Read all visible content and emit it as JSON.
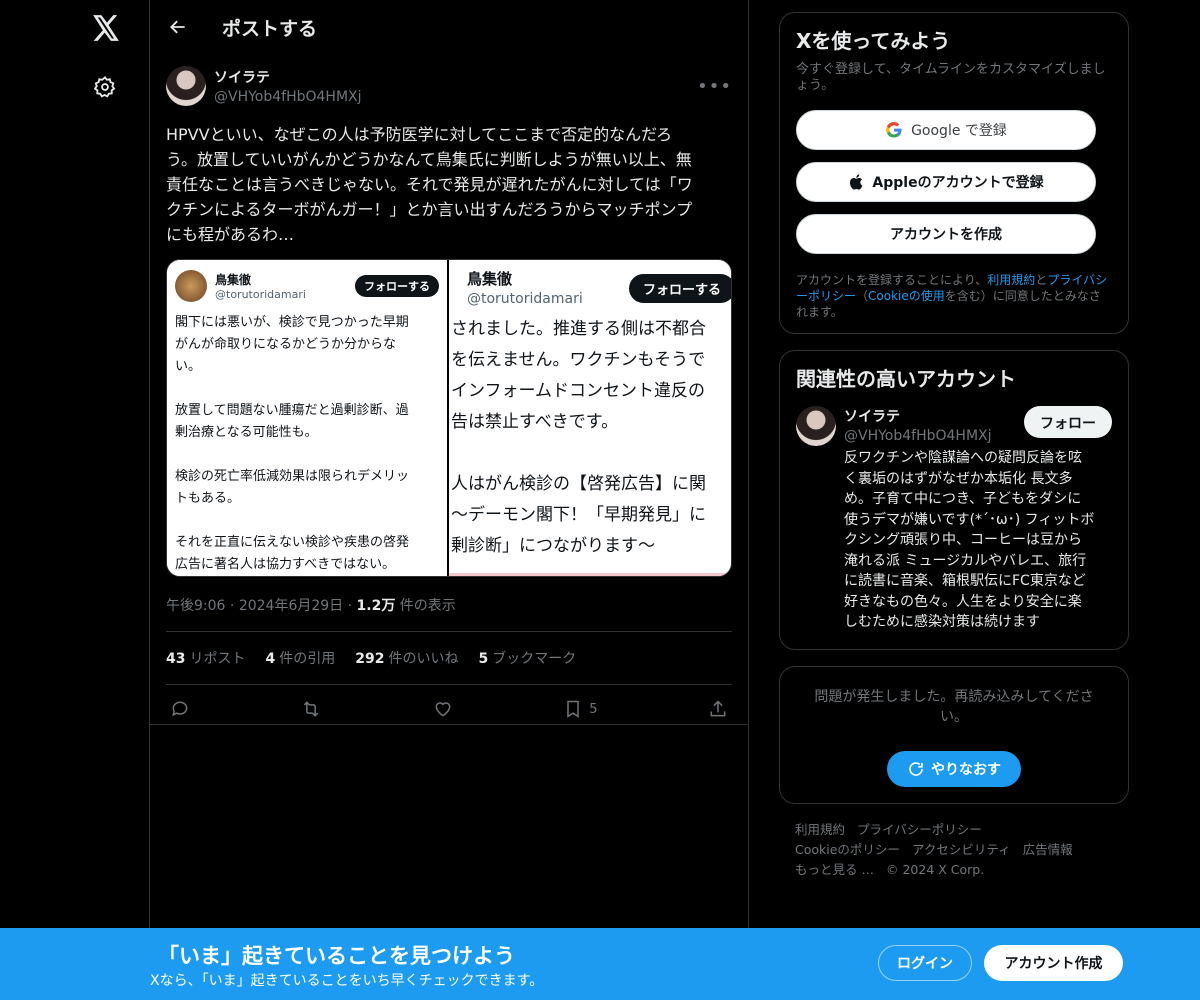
{
  "header": {
    "title": "ポストする"
  },
  "post": {
    "author_name": "ソイラテ",
    "author_handle": "@VHYob4fHbO4HMXj",
    "text": "HPVVといい、なぜこの人は予防医学に対してここまで否定的なんだろ\nう。放置していいがんかどうかなんて鳥集氏に判断しようが無い以上、無\n責任なことは言うべきじゃない。それで発見が遅れたがんに対しては「ワ\nクチンによるターボがんガー！」とか言い出すんだろうからマッチポンプ\nにも程があるわ…",
    "media_left": {
      "name": "鳥集徹",
      "handle": "@torutoridamari",
      "follow": "フォローする",
      "text": "閣下には悪いが、検診で見つかった早期\nがんが命取りになるかどうか分からな\nい。\n\n放置して問題ない腫瘍だと過剰診断、過\n剰治療となる可能性も。\n\n検診の死亡率低減効果は限られデメリッ\nトもある。\n\nそれを正直に伝えない検診や疾患の啓発\n広告に著名人は協力すべきではない。"
    },
    "media_right": {
      "name": "鳥集徹",
      "handle": "@torutoridamari",
      "follow": "フォローする",
      "text": "されました。推進する側は不都合\nを伝えません。ワクチンもそうで\nインフォームドコンセント違反の\n告は禁止すべきです。\n\n人はがん検診の【啓発広告】に関\n〜デーモン閣下！「早期発見」に\n剰診断」につながります〜"
    },
    "time": "午後9:06",
    "date": "2024年6月29日",
    "views_num": "1.2万",
    "views_label": "件の表示",
    "stats": [
      {
        "num": "43",
        "label": "リポスト"
      },
      {
        "num": "4",
        "label": "件の引用"
      },
      {
        "num": "292",
        "label": "件のいいね"
      },
      {
        "num": "5",
        "label": "ブックマーク"
      }
    ],
    "bookmark_count": "5"
  },
  "signup_card": {
    "title": "Xを使ってみよう",
    "subtitle": "今すぐ登録して、タイムラインをカスタマイズしましょう。",
    "google_button": "Google で登録",
    "apple_button": "Appleのアカウントで登録",
    "create_button": "アカウントを作成",
    "terms_prefix": "アカウントを登録することにより、",
    "terms_link": "利用規約",
    "terms_and": "と",
    "privacy_link": "プライバシーポリシー",
    "terms_paren_open": "（",
    "cookie_link": "Cookieの使用",
    "terms_suffix": "を含む）に同意したとみなされます。"
  },
  "related": {
    "title": "関連性の高いアカウント",
    "name": "ソイラテ",
    "handle": "@VHYob4fHbO4HMXj",
    "follow": "フォロー",
    "bio": "反ワクチンや陰謀論への疑問反論を呟\nく裏垢のはずがなぜか本垢化 長文多\nめ。子育て中につき、子どもをダシに\n使うデマが嫌いです(*´･ω･) フィットボ\nクシング頑張り中、コーヒーは豆から\n淹れる派 ミュージカルやバレエ、旅行\nに読書に音楽、箱根駅伝にFC東京など\n好きなもの色々。人生をより安全に楽\nしむために感染対策は続けます"
  },
  "error_card": {
    "message": "問題が発生しました。再読み込みしてくださ\nい。",
    "retry": "やりなおす"
  },
  "footer": {
    "line1": [
      "利用規約",
      "プライバシーポリシー"
    ],
    "line2": [
      "Cookieのポリシー",
      "アクセシビリティ",
      "広告情報"
    ],
    "more": "もっと見る …",
    "copyright": "© 2024 X Corp."
  },
  "bottom_bar": {
    "title": "「いま」起きていることを見つけよう",
    "subtitle": "Xなら、「いま」起きていることをいち早くチェックできます。",
    "login": "ログイン",
    "signup": "アカウント作成"
  },
  "colors": {
    "accent": "#1d9bf0",
    "background": "#000000",
    "border": "#2f3336",
    "muted": "#71767b"
  }
}
